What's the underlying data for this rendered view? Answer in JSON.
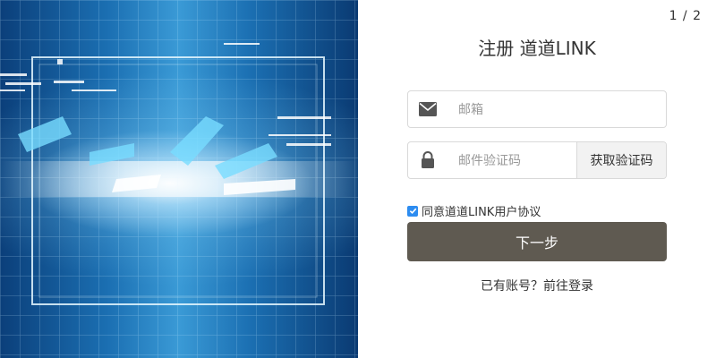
{
  "page_counter": "1 / 2",
  "title": "注册 道道LINK",
  "email_field": {
    "placeholder": "邮箱",
    "icon": "envelope-icon"
  },
  "code_field": {
    "placeholder": "邮件验证码",
    "icon": "lock-icon",
    "button_label": "获取验证码"
  },
  "agreement": {
    "label": "同意道道LINK用户协议",
    "checked": true
  },
  "next_button": "下一步",
  "login_link": "已有账号？前往登录",
  "colors": {
    "primary_button": "#5f5a51",
    "checkbox": "#2d8cf0",
    "icon": "#555555"
  }
}
